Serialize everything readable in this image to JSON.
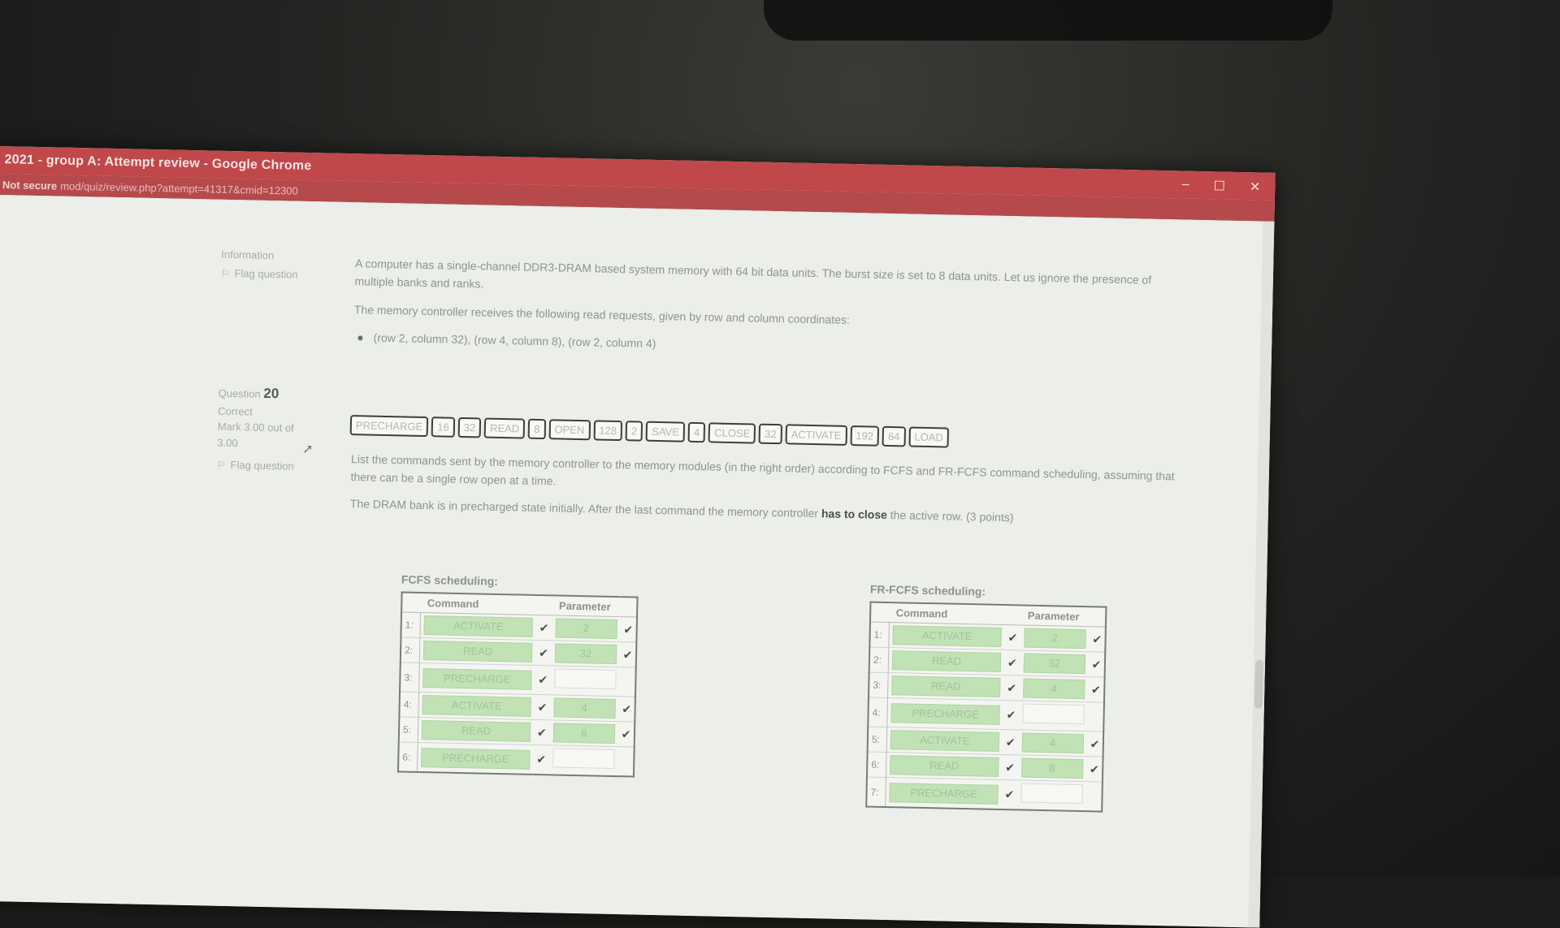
{
  "window": {
    "title": "2021 - group A: Attempt review - Google Chrome",
    "url_secure": "Not secure",
    "url_path": "mod/quiz/review.php?attempt=41317&cmid=12300",
    "controls": {
      "minimize": "–",
      "maximize": "☐",
      "close": "✕"
    }
  },
  "info": {
    "label": "Information",
    "flag": "Flag question"
  },
  "question": {
    "label": "Question",
    "number": "20",
    "status": "Correct",
    "mark": "Mark 3.00 out of 3.00",
    "flag": "Flag question"
  },
  "problem": {
    "p1": "A computer has a single-channel DDR3-DRAM based system memory with 64 bit data units. The burst size is set to 8 data units. Let us ignore the presence of multiple banks and ranks.",
    "p2": "The memory controller receives the following read requests, given by row and column coordinates:",
    "requests": "(row 2, column 32), (row 4, column 8), (row 2, column 4)"
  },
  "word_bank": [
    "PRECHARGE",
    "16",
    "32",
    "READ",
    "8",
    "OPEN",
    "128",
    "2",
    "SAVE",
    "4",
    "CLOSE",
    "32",
    "ACTIVATE",
    "192",
    "64",
    "LOAD"
  ],
  "instructions": {
    "p1": "List the commands sent by the memory controller to the memory modules (in the right order) according to FCFS and FR-FCFS command scheduling, assuming that there can be a single row open at a time.",
    "p2_pre": "The DRAM bank is in precharged state initially. After the last command the memory controller ",
    "p2_bold": "has to close",
    "p2_post": " the active row. (3 points)"
  },
  "fcfs": {
    "title": "FCFS scheduling:",
    "headers": {
      "command": "Command",
      "parameter": "Parameter"
    },
    "rows": [
      {
        "num": "1:",
        "command": "ACTIVATE",
        "param": "2",
        "check": "✔",
        "param_check": "✔"
      },
      {
        "num": "2:",
        "command": "READ",
        "param": "32",
        "check": "✔",
        "param_check": "✔"
      },
      {
        "num": "3:",
        "command": "PRECHARGE",
        "param": "",
        "check": "✔",
        "param_check": ""
      },
      {
        "num": "4:",
        "command": "ACTIVATE",
        "param": "4",
        "check": "✔",
        "param_check": "✔"
      },
      {
        "num": "5:",
        "command": "READ",
        "param": "8",
        "check": "✔",
        "param_check": "✔"
      },
      {
        "num": "6:",
        "command": "PRECHARGE",
        "param": "",
        "check": "✔",
        "param_check": ""
      }
    ]
  },
  "frfcfs": {
    "title": "FR-FCFS scheduling:",
    "headers": {
      "command": "Command",
      "parameter": "Parameter"
    },
    "rows": [
      {
        "num": "1:",
        "command": "ACTIVATE",
        "param": "2",
        "check": "✔",
        "param_check": "✔"
      },
      {
        "num": "2:",
        "command": "READ",
        "param": "32",
        "check": "✔",
        "param_check": "✔"
      },
      {
        "num": "3:",
        "command": "READ",
        "param": "4",
        "check": "✔",
        "param_check": "✔"
      },
      {
        "num": "4:",
        "command": "PRECHARGE",
        "param": "",
        "check": "✔",
        "param_check": ""
      },
      {
        "num": "5:",
        "command": "ACTIVATE",
        "param": "4",
        "check": "✔",
        "param_check": "✔"
      },
      {
        "num": "6:",
        "command": "READ",
        "param": "8",
        "check": "✔",
        "param_check": "✔"
      },
      {
        "num": "7:",
        "command": "PRECHARGE",
        "param": "",
        "check": "✔",
        "param_check": ""
      }
    ]
  },
  "colors": {
    "titlebar": "#c0474a",
    "correct_fill": "#c0e2b5",
    "page_bg": "#eceeea"
  }
}
